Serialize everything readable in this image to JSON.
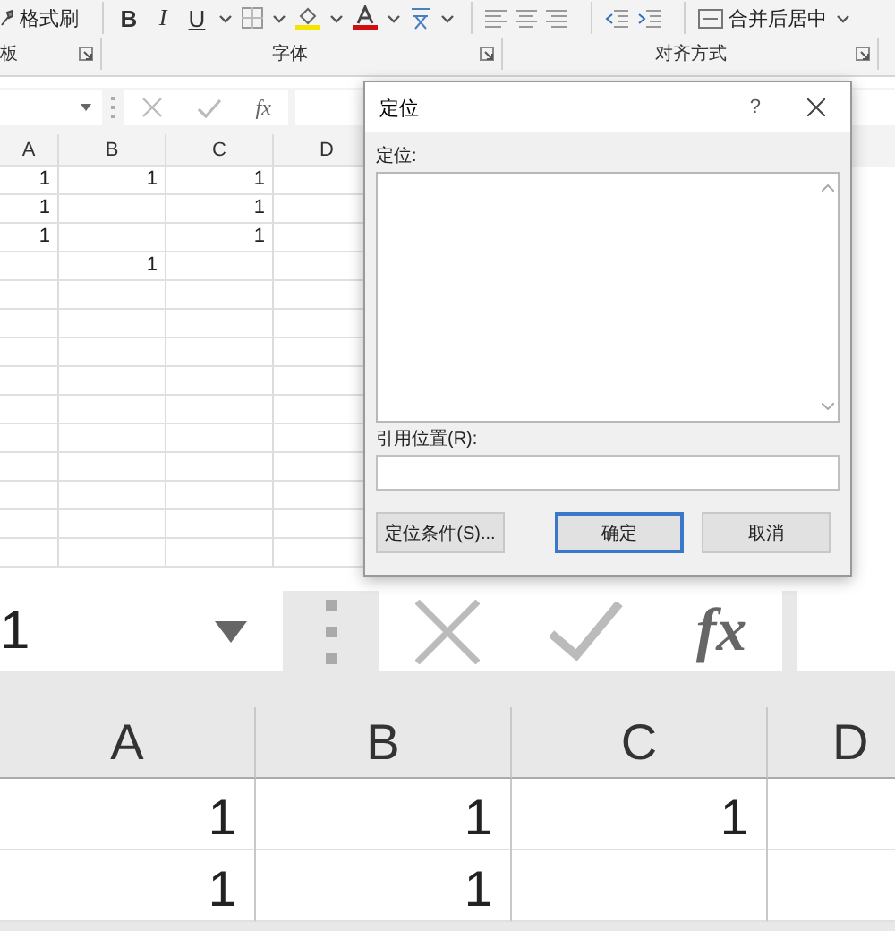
{
  "ribbon": {
    "clipboard": {
      "format_painter": "格式刷",
      "group_label": "板"
    },
    "font": {
      "bold": "B",
      "italic": "I",
      "underline": "U",
      "group_label": "字体"
    },
    "alignment": {
      "merge_center": "合并后居中",
      "group_label": "对齐方式"
    }
  },
  "formula_bar": {
    "fx": "fx"
  },
  "sheet": {
    "columns": [
      "A",
      "B",
      "C",
      "D"
    ],
    "rows": [
      [
        "1",
        "1",
        "1",
        null
      ],
      [
        "1",
        null,
        "1",
        null
      ],
      [
        "1",
        null,
        "1",
        null
      ],
      [
        null,
        "1",
        null,
        null
      ]
    ]
  },
  "dialog": {
    "title": "定位",
    "help": "?",
    "list_label": "定位:",
    "reference_label": "引用位置(R):",
    "buttons": [
      {
        "label": "定位条件(S)...",
        "selected": false
      },
      {
        "label": "确定",
        "selected": true
      },
      {
        "label": "取消",
        "selected": false
      }
    ]
  },
  "zoomed": {
    "formula_bar": {
      "name_box": "1",
      "fx": "fx"
    },
    "columns": [
      "A",
      "B",
      "C",
      "D"
    ],
    "rows": [
      [
        "1",
        "1",
        "1",
        null
      ],
      [
        "1",
        "1",
        null,
        null
      ]
    ]
  }
}
